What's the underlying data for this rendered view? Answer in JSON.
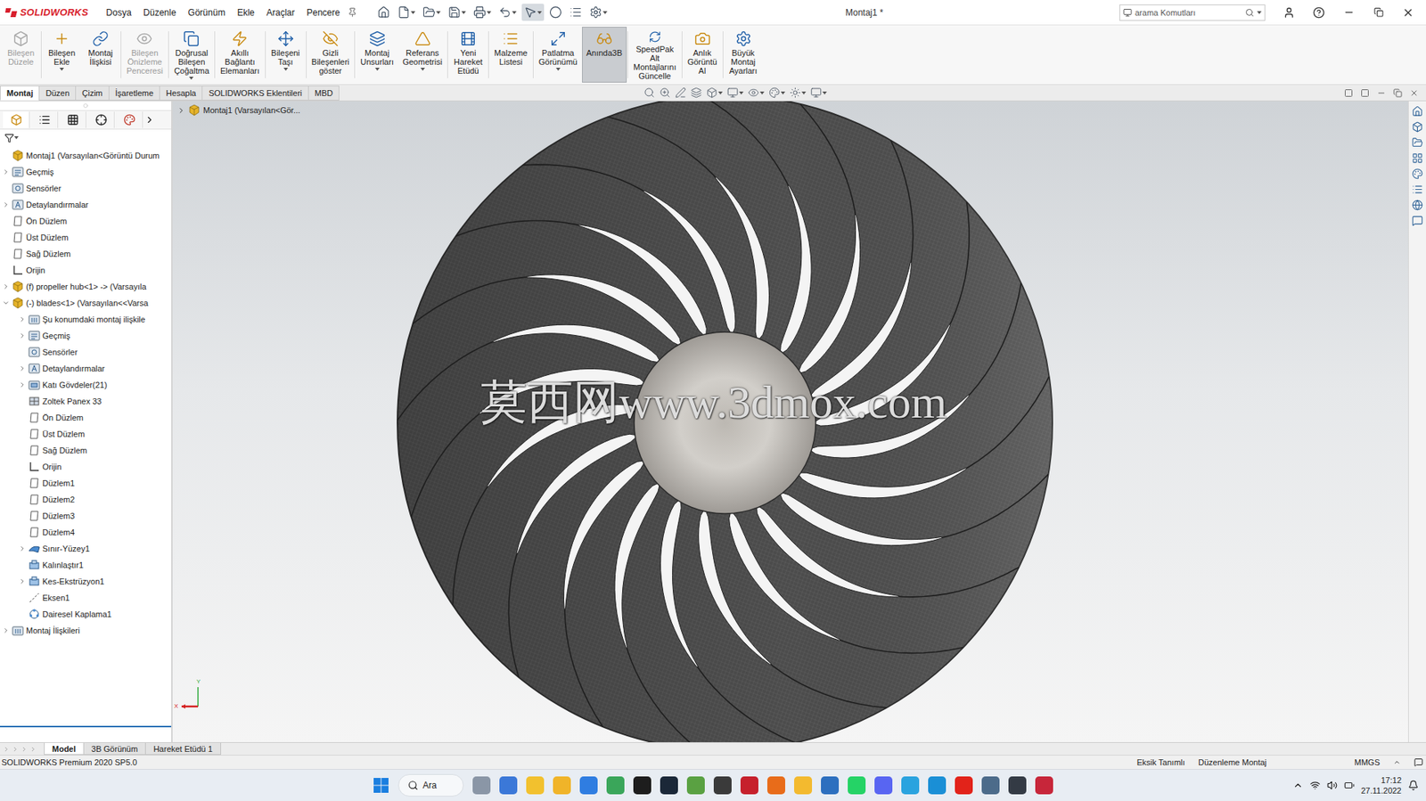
{
  "app": {
    "logo": "SOLIDWORKS",
    "title": "Montaj1 *"
  },
  "menu": [
    {
      "label": "Dosya"
    },
    {
      "label": "Düzenle"
    },
    {
      "label": "Görünüm"
    },
    {
      "label": "Ekle"
    },
    {
      "label": "Araçlar"
    },
    {
      "label": "Pencere"
    }
  ],
  "search": {
    "placeholder": "arama Komutları"
  },
  "ribbon": [
    {
      "label": "Bileşen Düzele",
      "disabled": true,
      "selected": false,
      "dropdown": false
    },
    {
      "label": "Bileşen Ekle",
      "disabled": false,
      "selected": false,
      "dropdown": true
    },
    {
      "label": "Montaj İlişkisi",
      "disabled": false,
      "selected": false,
      "dropdown": false
    },
    {
      "label": "Bileşen Önizleme Penceresi",
      "disabled": true,
      "selected": false,
      "dropdown": false
    },
    {
      "label": "Doğrusal Bileşen Çoğaltma",
      "disabled": false,
      "selected": false,
      "dropdown": true
    },
    {
      "label": "Akıllı Bağlantı Elemanları",
      "disabled": false,
      "selected": false,
      "dropdown": false
    },
    {
      "label": "Bileşeni Taşı",
      "disabled": false,
      "selected": false,
      "dropdown": true
    },
    {
      "label": "Gizli Bileşenleri göster",
      "disabled": false,
      "selected": false,
      "dropdown": false
    },
    {
      "label": "Montaj Unsurları",
      "disabled": false,
      "selected": false,
      "dropdown": true
    },
    {
      "label": "Referans Geometrisi",
      "disabled": false,
      "selected": false,
      "dropdown": true
    },
    {
      "label": "Yeni Hareket Etüdü",
      "disabled": false,
      "selected": false,
      "dropdown": false
    },
    {
      "label": "Malzeme Listesi",
      "disabled": false,
      "selected": false,
      "dropdown": false
    },
    {
      "label": "Patlatma Görünümü",
      "disabled": false,
      "selected": false,
      "dropdown": true
    },
    {
      "label": "Anında3B",
      "disabled": false,
      "selected": true,
      "dropdown": false
    },
    {
      "label": "SpeedPak Alt Montajlarını Güncelle",
      "disabled": false,
      "selected": false,
      "dropdown": false
    },
    {
      "label": "Anlık Görüntü Al",
      "disabled": false,
      "selected": false,
      "dropdown": false
    },
    {
      "label": "Büyük Montaj Ayarları",
      "disabled": false,
      "selected": false,
      "dropdown": false
    }
  ],
  "tabs": [
    {
      "label": "Montaj",
      "selected": true
    },
    {
      "label": "Düzen",
      "selected": false
    },
    {
      "label": "Çizim",
      "selected": false
    },
    {
      "label": "İşaretleme",
      "selected": false
    },
    {
      "label": "Hesapla",
      "selected": false
    },
    {
      "label": "SOLIDWORKS Eklentileri",
      "selected": false
    },
    {
      "label": "MBD",
      "selected": false
    }
  ],
  "feature_tree": {
    "items": [
      {
        "label": "Montaj1  (Varsayılan<Görüntü Durum",
        "depth": 0,
        "kind": "assembly",
        "expandable": false,
        "expanded": false
      },
      {
        "label": "Geçmiş",
        "depth": 0,
        "kind": "history",
        "expandable": true,
        "expanded": false
      },
      {
        "label": "Sensörler",
        "depth": 0,
        "kind": "sensor",
        "expandable": false,
        "expanded": false
      },
      {
        "label": "Detaylandırmalar",
        "depth": 0,
        "kind": "annotation",
        "expandable": true,
        "expanded": false
      },
      {
        "label": "Ön Düzlem",
        "depth": 0,
        "kind": "plane",
        "expandable": false,
        "expanded": false
      },
      {
        "label": "Üst Düzlem",
        "depth": 0,
        "kind": "plane",
        "expandable": false,
        "expanded": false
      },
      {
        "label": "Sağ Düzlem",
        "depth": 0,
        "kind": "plane",
        "expandable": false,
        "expanded": false
      },
      {
        "label": "Orijin",
        "depth": 0,
        "kind": "origin",
        "expandable": false,
        "expanded": false
      },
      {
        "label": "(f) propeller hub<1> -> (Varsayıla",
        "depth": 0,
        "kind": "part",
        "expandable": true,
        "expanded": false
      },
      {
        "label": "(-) blades<1> (Varsayılan<<Varsa",
        "depth": 0,
        "kind": "part",
        "expandable": true,
        "expanded": true
      },
      {
        "label": "Şu konumdaki montaj ilişkile",
        "depth": 1,
        "kind": "mates-folder",
        "expandable": true,
        "expanded": false
      },
      {
        "label": "Geçmiş",
        "depth": 1,
        "kind": "history",
        "expandable": true,
        "expanded": false
      },
      {
        "label": "Sensörler",
        "depth": 1,
        "kind": "sensor",
        "expandable": false,
        "expanded": false
      },
      {
        "label": "Detaylandırmalar",
        "depth": 1,
        "kind": "annotation",
        "expandable": true,
        "expanded": false
      },
      {
        "label": "Katı Gövdeler(21)",
        "depth": 1,
        "kind": "bodies",
        "expandable": true,
        "expanded": false
      },
      {
        "label": "Zoltek Panex 33",
        "depth": 1,
        "kind": "material",
        "expandable": false,
        "expanded": false
      },
      {
        "label": "Ön Düzlem",
        "depth": 1,
        "kind": "plane",
        "expandable": false,
        "expanded": false
      },
      {
        "label": "Üst Düzlem",
        "depth": 1,
        "kind": "plane",
        "expandable": false,
        "expanded": false
      },
      {
        "label": "Sağ Düzlem",
        "depth": 1,
        "kind": "plane",
        "expandable": false,
        "expanded": false
      },
      {
        "label": "Orijin",
        "depth": 1,
        "kind": "origin",
        "expandable": false,
        "expanded": false
      },
      {
        "label": "Düzlem1",
        "depth": 1,
        "kind": "plane",
        "expandable": false,
        "expanded": false
      },
      {
        "label": "Düzlem2",
        "depth": 1,
        "kind": "plane",
        "expandable": false,
        "expanded": false
      },
      {
        "label": "Düzlem3",
        "depth": 1,
        "kind": "plane",
        "expandable": false,
        "expanded": false
      },
      {
        "label": "Düzlem4",
        "depth": 1,
        "kind": "plane",
        "expandable": false,
        "expanded": false
      },
      {
        "label": "Sınır-Yüzey1",
        "depth": 1,
        "kind": "surface",
        "expandable": true,
        "expanded": false
      },
      {
        "label": "Kalınlaştır1",
        "depth": 1,
        "kind": "feature",
        "expandable": false,
        "expanded": false
      },
      {
        "label": "Kes-Ekstrüzyon1",
        "depth": 1,
        "kind": "feature",
        "expandable": true,
        "expanded": false
      },
      {
        "label": "Eksen1",
        "depth": 1,
        "kind": "axis",
        "expandable": false,
        "expanded": false
      },
      {
        "label": "Dairesel Kaplama1",
        "depth": 1,
        "kind": "pattern",
        "expandable": false,
        "expanded": false
      },
      {
        "label": "Montaj İlişkileri",
        "depth": 0,
        "kind": "mates",
        "expandable": true,
        "expanded": false
      }
    ]
  },
  "viewport": {
    "breadcrumb": "Montaj1  (Varsayılan<Gör...",
    "watermark": "莫西网www.3dmox.com",
    "triad": {
      "x": "X",
      "y": "Y"
    }
  },
  "bottom_tabs": [
    {
      "label": "Model",
      "selected": true
    },
    {
      "label": "3B Görünüm",
      "selected": false
    },
    {
      "label": "Hareket Etüdü 1",
      "selected": false
    }
  ],
  "status_bar": {
    "product": "SOLIDWORKS Premium 2020 SP5.0",
    "status": "Eksik Tanımlı",
    "mode": "Düzenleme Montaj",
    "units": "MMGS"
  },
  "taskbar": {
    "search": "Ara",
    "time": "17:12",
    "date": "27.11.2022"
  }
}
